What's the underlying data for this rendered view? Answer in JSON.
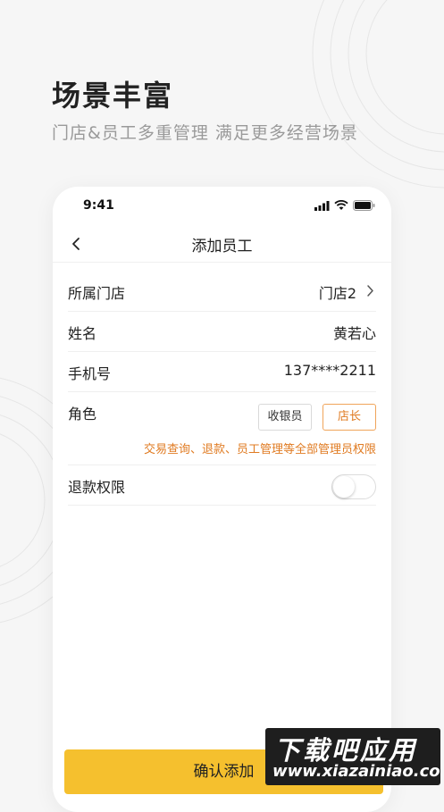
{
  "headline": "场景丰富",
  "subline": "门店&员工多重管理  满足更多经营场景",
  "phone": {
    "status_time": "9:41",
    "nav_title": "添加员工",
    "form": {
      "store": {
        "label": "所属门店",
        "value": "门店2"
      },
      "name": {
        "label": "姓名",
        "value": "黄若心"
      },
      "phone": {
        "label": "手机号",
        "value": "137****2211"
      },
      "role": {
        "label": "角色",
        "options": [
          "收银员",
          "店长"
        ],
        "selected": "店长",
        "hint": "交易查询、退款、员工管理等全部管理员权限"
      },
      "refund": {
        "label": "退款权限",
        "enabled": false
      }
    },
    "confirm_label": "确认添加"
  },
  "watermark": {
    "title": "下载吧应用",
    "url": "www.xiazaiниao.com"
  },
  "colors": {
    "accent": "#f5c02e",
    "highlight": "#e07b22",
    "background": "#f6f6f6"
  }
}
